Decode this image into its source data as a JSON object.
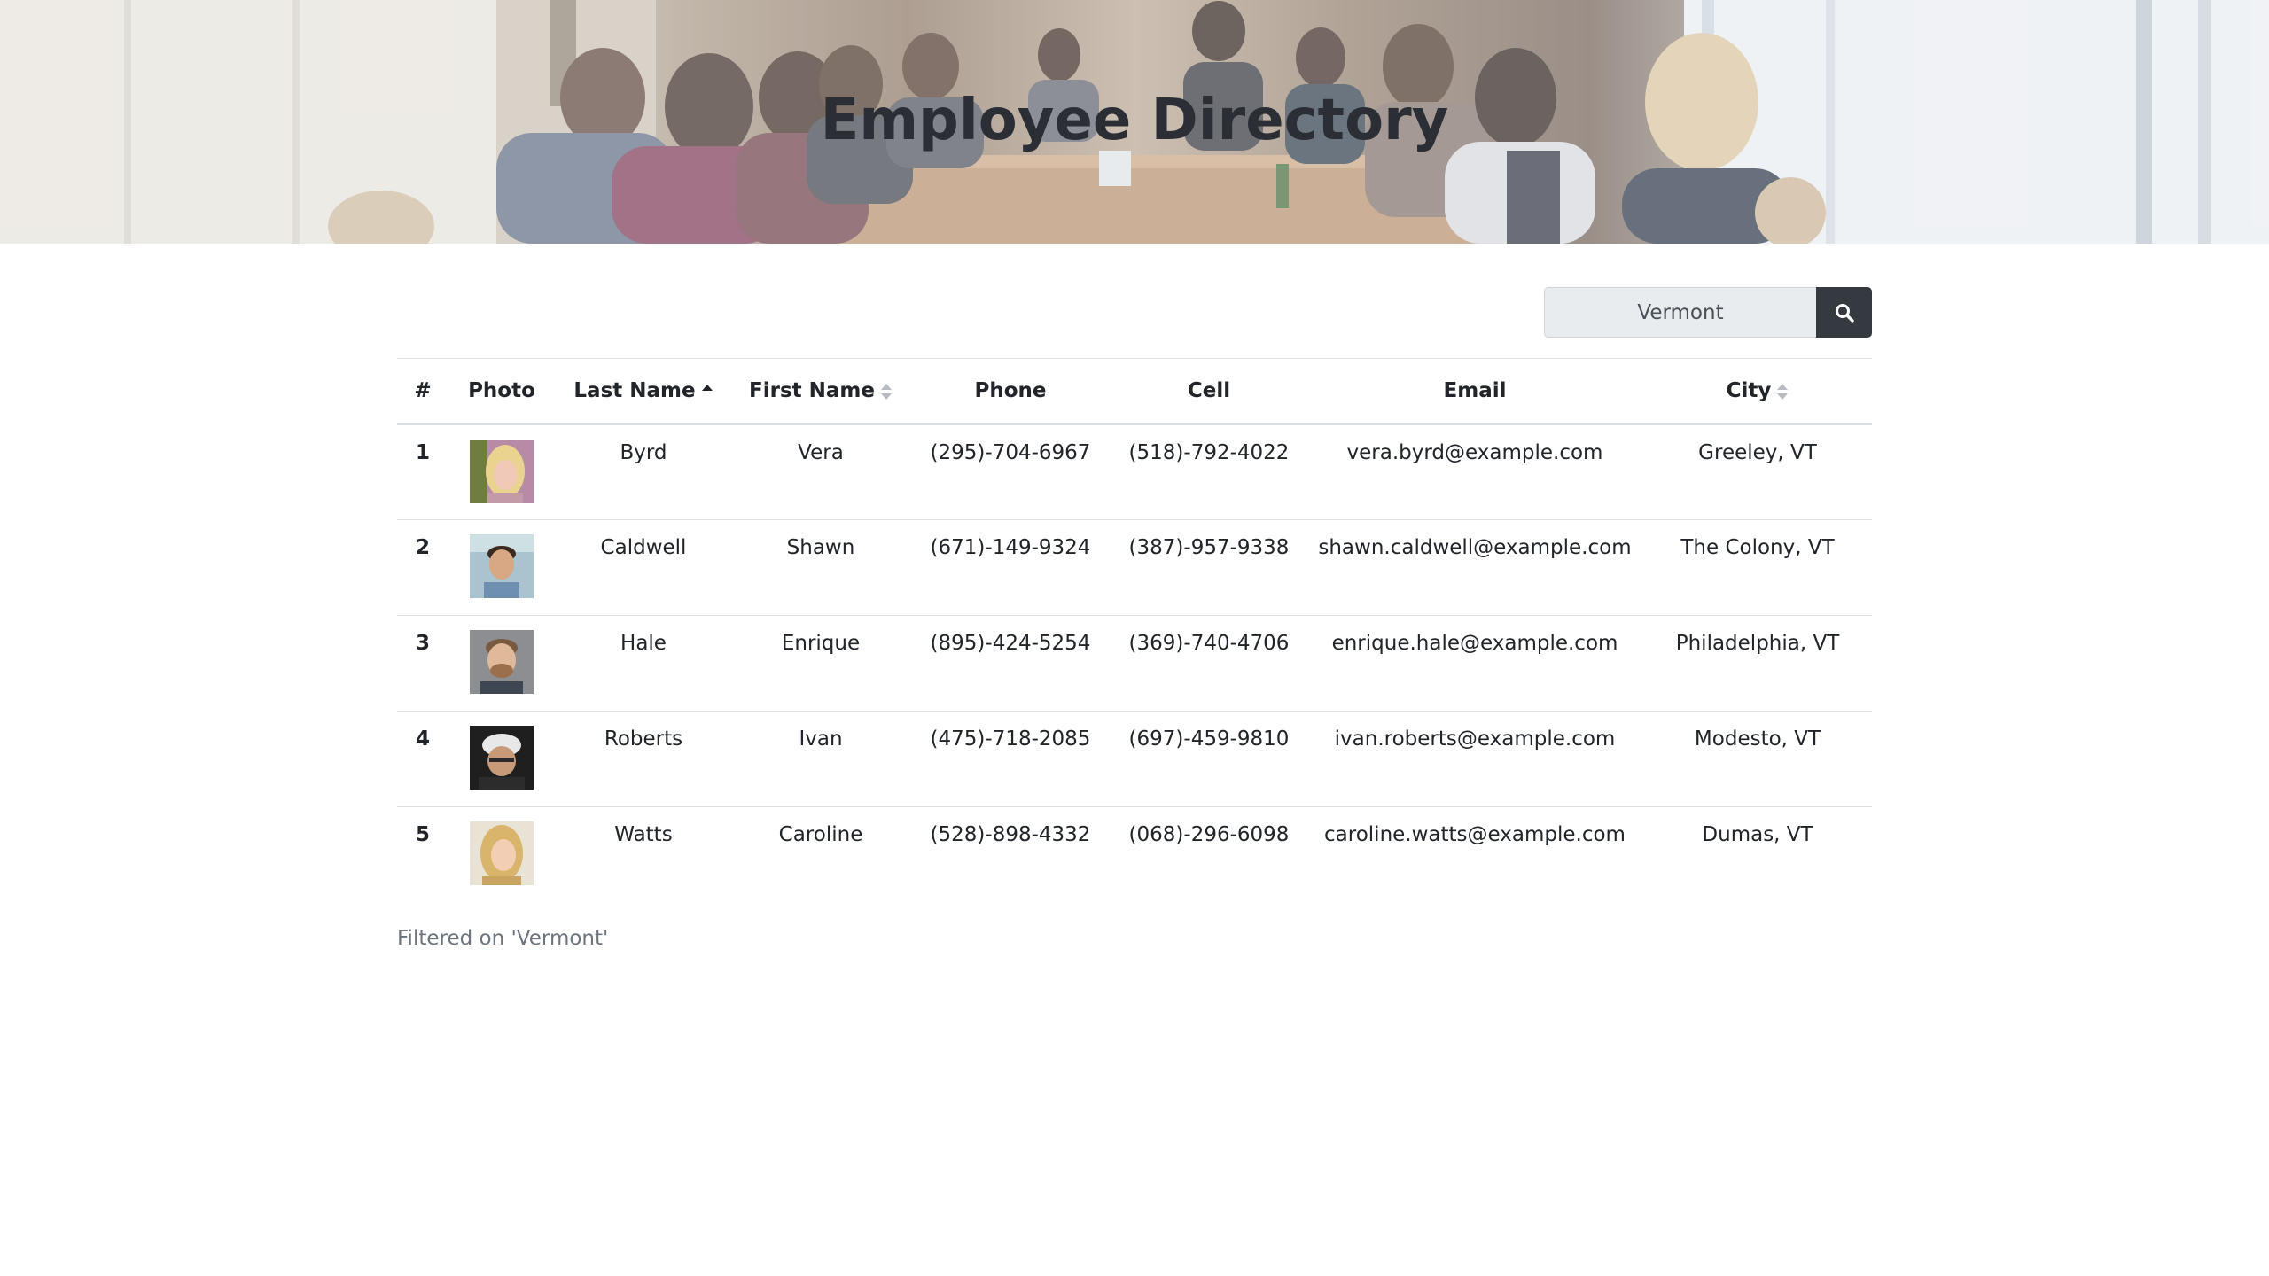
{
  "hero": {
    "title": "Employee Directory"
  },
  "search": {
    "value": "Vermont",
    "button_icon": "search-icon"
  },
  "table": {
    "columns": [
      {
        "label": "#"
      },
      {
        "label": "Photo"
      },
      {
        "label": "Last Name",
        "sort": "ascending"
      },
      {
        "label": "First Name",
        "sort": "unsorted"
      },
      {
        "label": "Phone"
      },
      {
        "label": "Cell"
      },
      {
        "label": "Email"
      },
      {
        "label": "City",
        "sort": "unsorted"
      }
    ],
    "rows": [
      {
        "num": "1",
        "last": "Byrd",
        "first": "Vera",
        "phone": "(295)-704-6967",
        "cell": "(518)-792-4022",
        "email": "vera.byrd@example.com",
        "city": "Greeley, VT"
      },
      {
        "num": "2",
        "last": "Caldwell",
        "first": "Shawn",
        "phone": "(671)-149-9324",
        "cell": "(387)-957-9338",
        "email": "shawn.caldwell@example.com",
        "city": "The Colony, VT"
      },
      {
        "num": "3",
        "last": "Hale",
        "first": "Enrique",
        "phone": "(895)-424-5254",
        "cell": "(369)-740-4706",
        "email": "enrique.hale@example.com",
        "city": "Philadelphia, VT"
      },
      {
        "num": "4",
        "last": "Roberts",
        "first": "Ivan",
        "phone": "(475)-718-2085",
        "cell": "(697)-459-9810",
        "email": "ivan.roberts@example.com",
        "city": "Modesto, VT"
      },
      {
        "num": "5",
        "last": "Watts",
        "first": "Caroline",
        "phone": "(528)-898-4332",
        "cell": "(068)-296-6098",
        "email": "caroline.watts@example.com",
        "city": "Dumas, VT"
      }
    ]
  },
  "footer": {
    "filter_note": "Filtered on 'Vermont'"
  },
  "colors": {
    "header_text": "#2b2f35",
    "search_button": "#343a40",
    "search_field": "#e9ecef",
    "muted_text": "#6c757d",
    "divider": "#dee2e6"
  }
}
